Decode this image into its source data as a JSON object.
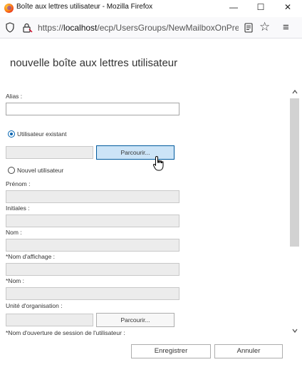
{
  "window": {
    "title": "Boîte aux lettres utilisateur - Mozilla Firefox",
    "minimize": "—",
    "maximize": "☐",
    "close": "✕"
  },
  "addressbar": {
    "url_prefix": "https://",
    "url_host": "localhost",
    "url_path": "/ecp/UsersGroups/NewMailboxOnPrem"
  },
  "page": {
    "title": "nouvelle boîte aux lettres utilisateur"
  },
  "form": {
    "alias_label": "Alias :",
    "alias_value": "",
    "existing_user_label": "Utilisateur existant",
    "existing_user_checked": true,
    "existing_user_value": "",
    "browse_label": "Parcourir...",
    "new_user_label": "Nouvel utilisateur",
    "new_user_checked": false,
    "first_name_label": "Prénom :",
    "initials_label": "Initiales :",
    "last_name_label": "Nom :",
    "display_name_label": "*Nom d'affichage :",
    "name_label": "*Nom :",
    "ou_label": "Unité d'organisation :",
    "ou_browse_label": "Parcourir...",
    "logon_name_label": "*Nom d'ouverture de session de l'utilisateur :"
  },
  "footer": {
    "save_label": "Enregistrer",
    "cancel_label": "Annuler"
  },
  "colors": {
    "accent": "#0063b1",
    "hover_button": "#cce4f7",
    "disabled_field": "#ececec"
  },
  "icons": [
    "firefox-logo-icon",
    "shield-icon",
    "lock-icon",
    "reader-view-icon",
    "star-icon",
    "hamburger-menu-icon",
    "scroll-up-icon",
    "scroll-down-icon",
    "hand-cursor-icon"
  ]
}
